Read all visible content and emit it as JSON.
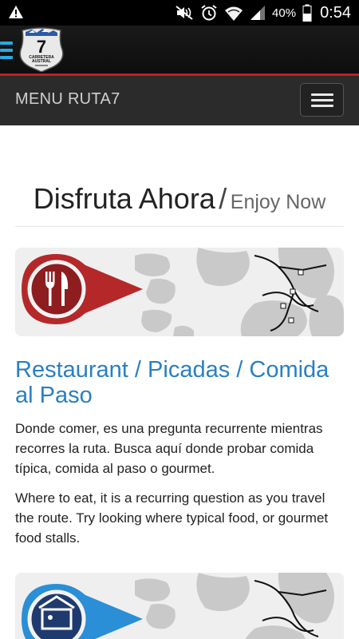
{
  "status_bar": {
    "battery": "40%",
    "time": "0:54"
  },
  "menu": {
    "title": "MENU RUTA7"
  },
  "logo": {
    "number": "7",
    "line1": "CARRETERA",
    "line2": "AUSTRAL"
  },
  "section": {
    "title": "Disfruta Ahora",
    "separator": "/",
    "subtitle": "Enjoy Now"
  },
  "cards": [
    {
      "heading": "Restaurant / Picadas / Comida al Paso",
      "text_es": "Donde comer, es una pregunta recurrente mientras recorres la ruta. Busca aquí donde probar comida típica, comida al paso o gourmet.",
      "text_en": "Where to eat, it is a recurring question as you travel the route. Try looking where typical food, or gourmet food stalls."
    }
  ],
  "colors": {
    "accent_blue": "#2a7fc1",
    "pin_red": "#b5282a",
    "pin_blue": "#2a8fd6",
    "header_red_line": "#c0201f"
  },
  "icons": {
    "food": "fork-knife-icon",
    "lodging": "bed-icon"
  }
}
